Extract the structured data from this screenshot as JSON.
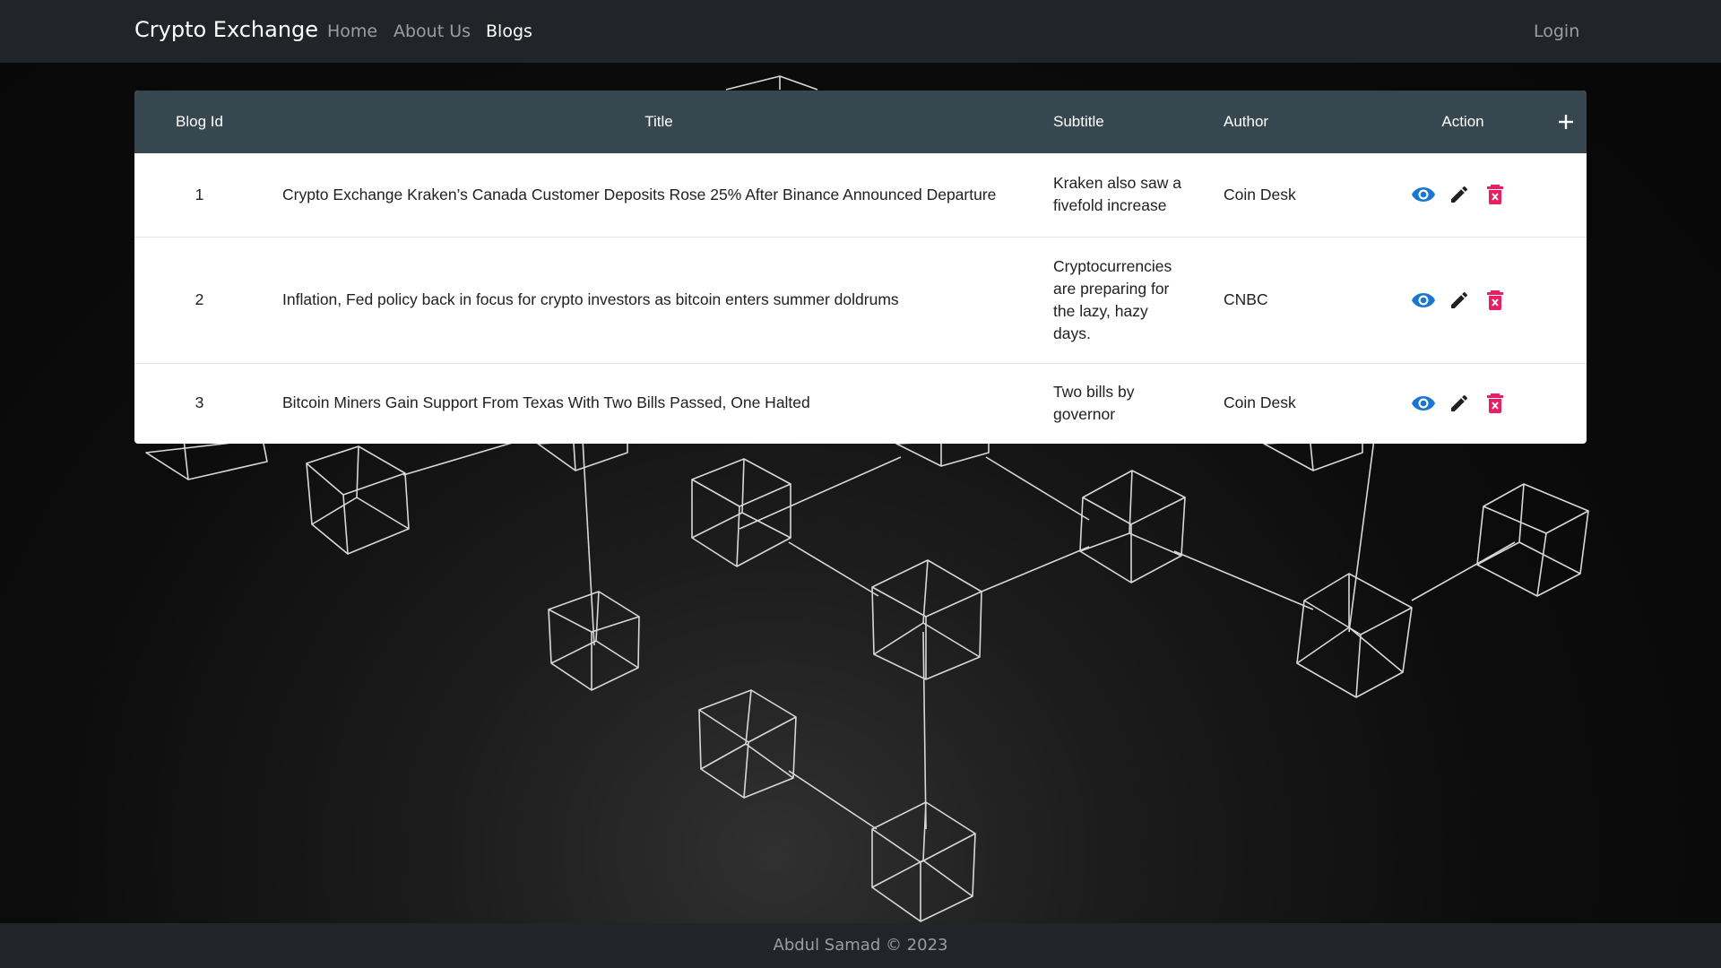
{
  "navbar": {
    "brand": "Crypto Exchange",
    "links": [
      {
        "label": "Home",
        "active": false
      },
      {
        "label": "About Us",
        "active": false
      },
      {
        "label": "Blogs",
        "active": true
      }
    ],
    "login": "Login"
  },
  "table": {
    "headers": {
      "id": "Blog Id",
      "title": "Title",
      "subtitle": "Subtitle",
      "author": "Author",
      "action": "Action"
    },
    "rows": [
      {
        "id": "1",
        "title": "Crypto Exchange Kraken’s Canada Customer Deposits Rose 25% After Binance Announced Departure",
        "subtitle": "Kraken also saw a fivefold increase",
        "author": "Coin Desk"
      },
      {
        "id": "2",
        "title": "Inflation, Fed policy back in focus for crypto investors as bitcoin enters summer doldrums",
        "subtitle": "Cryptocurrencies are preparing for the lazy, hazy days.",
        "author": "CNBC"
      },
      {
        "id": "3",
        "title": "Bitcoin Miners Gain Support From Texas With Two Bills Passed, One Halted",
        "subtitle": "Two bills by governor",
        "author": "Coin Desk"
      }
    ],
    "icons": {
      "view": "eye-icon",
      "edit": "pencil-icon",
      "delete": "trash-icon",
      "add": "plus-icon"
    },
    "colors": {
      "header_bg": "#37474f",
      "view": "#1976d2",
      "edit": "#212121",
      "delete": "#e91e63"
    }
  },
  "footer": {
    "text": "Abdul Samad © 2023"
  }
}
